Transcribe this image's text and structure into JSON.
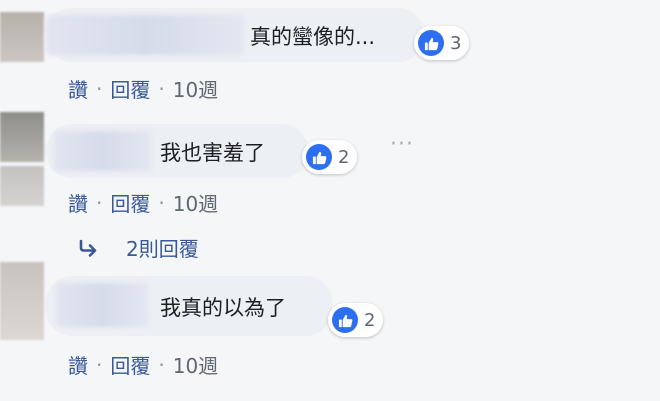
{
  "comments": [
    {
      "text": "真的蠻像的...",
      "reactions": "3",
      "actions": {
        "like": "讚",
        "reply": "回覆",
        "time": "10週"
      }
    },
    {
      "text": "我也害羞了",
      "reactions": "2",
      "actions": {
        "like": "讚",
        "reply": "回覆",
        "time": "10週"
      },
      "more": "···"
    },
    {
      "text": "我真的以為了",
      "reactions": "2",
      "actions": {
        "like": "讚",
        "reply": "回覆",
        "time": "10週"
      }
    }
  ],
  "replies_link": "2則回覆",
  "colors": {
    "like_blue": "#2d6ff0",
    "link_blue": "#385898",
    "bubble": "#eceff3"
  },
  "icons": {
    "reaction": "thumbs-up-icon",
    "replies": "reply-arrow-icon"
  }
}
